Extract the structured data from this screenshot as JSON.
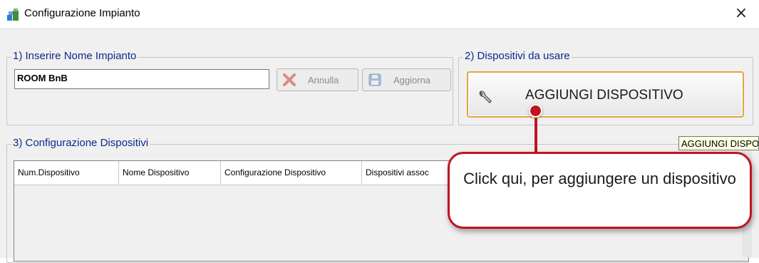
{
  "window": {
    "title": "Configurazione Impianto",
    "close_symbol": "×",
    "icon": "app-icon"
  },
  "group1": {
    "legend": "1) Inserire Nome Impianto",
    "name_value": "ROOM BnB",
    "annulla_label": "Annulla",
    "aggiorna_label": "Aggiorna"
  },
  "group2": {
    "legend": "2) Dispositivi da usare",
    "add_label": "AGGIUNGI DISPOSITIVO",
    "add_icon": "wrench-icon",
    "border_color": "#e0a83a"
  },
  "group3": {
    "legend": "3) Configurazione Dispositivi",
    "columns": [
      "Num.Dispositivo",
      "Nome Dispositivo",
      "Configurazione Dispositivo",
      "Dispositivi assoc"
    ]
  },
  "tooltip": "AGGIUNGI DISPOSITIVO",
  "callout": {
    "text": "Click qui, per aggiungere un dispositivo",
    "accent": "#c0141e"
  }
}
